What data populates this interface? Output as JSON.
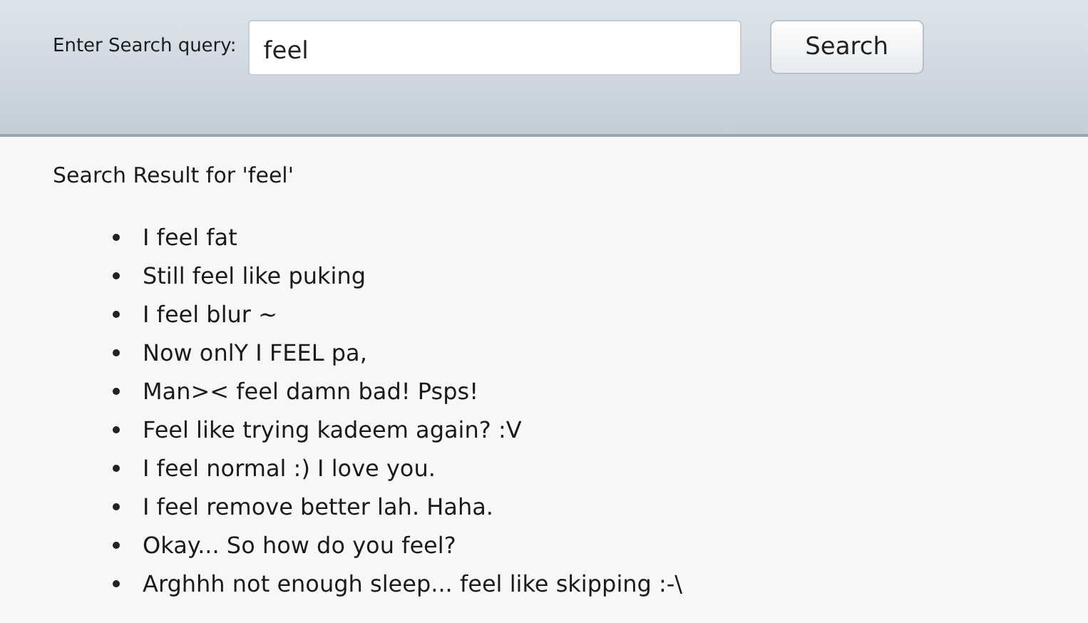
{
  "search": {
    "label": "Enter Search query:",
    "value": "feel",
    "button": "Search"
  },
  "results": {
    "heading": "Search Result for 'feel'",
    "items": [
      "I feel fat",
      "Still feel like puking",
      "I feel blur ~",
      "Now onlY I FEEL pa,",
      "Man>< feel damn bad! Psps!",
      "Feel like trying kadeem again? :V",
      "I feel normal :) I love you.",
      "I feel remove better lah. Haha.",
      "Okay... So how do you feel?",
      "Arghhh not enough sleep... feel like skipping :-\\"
    ]
  }
}
